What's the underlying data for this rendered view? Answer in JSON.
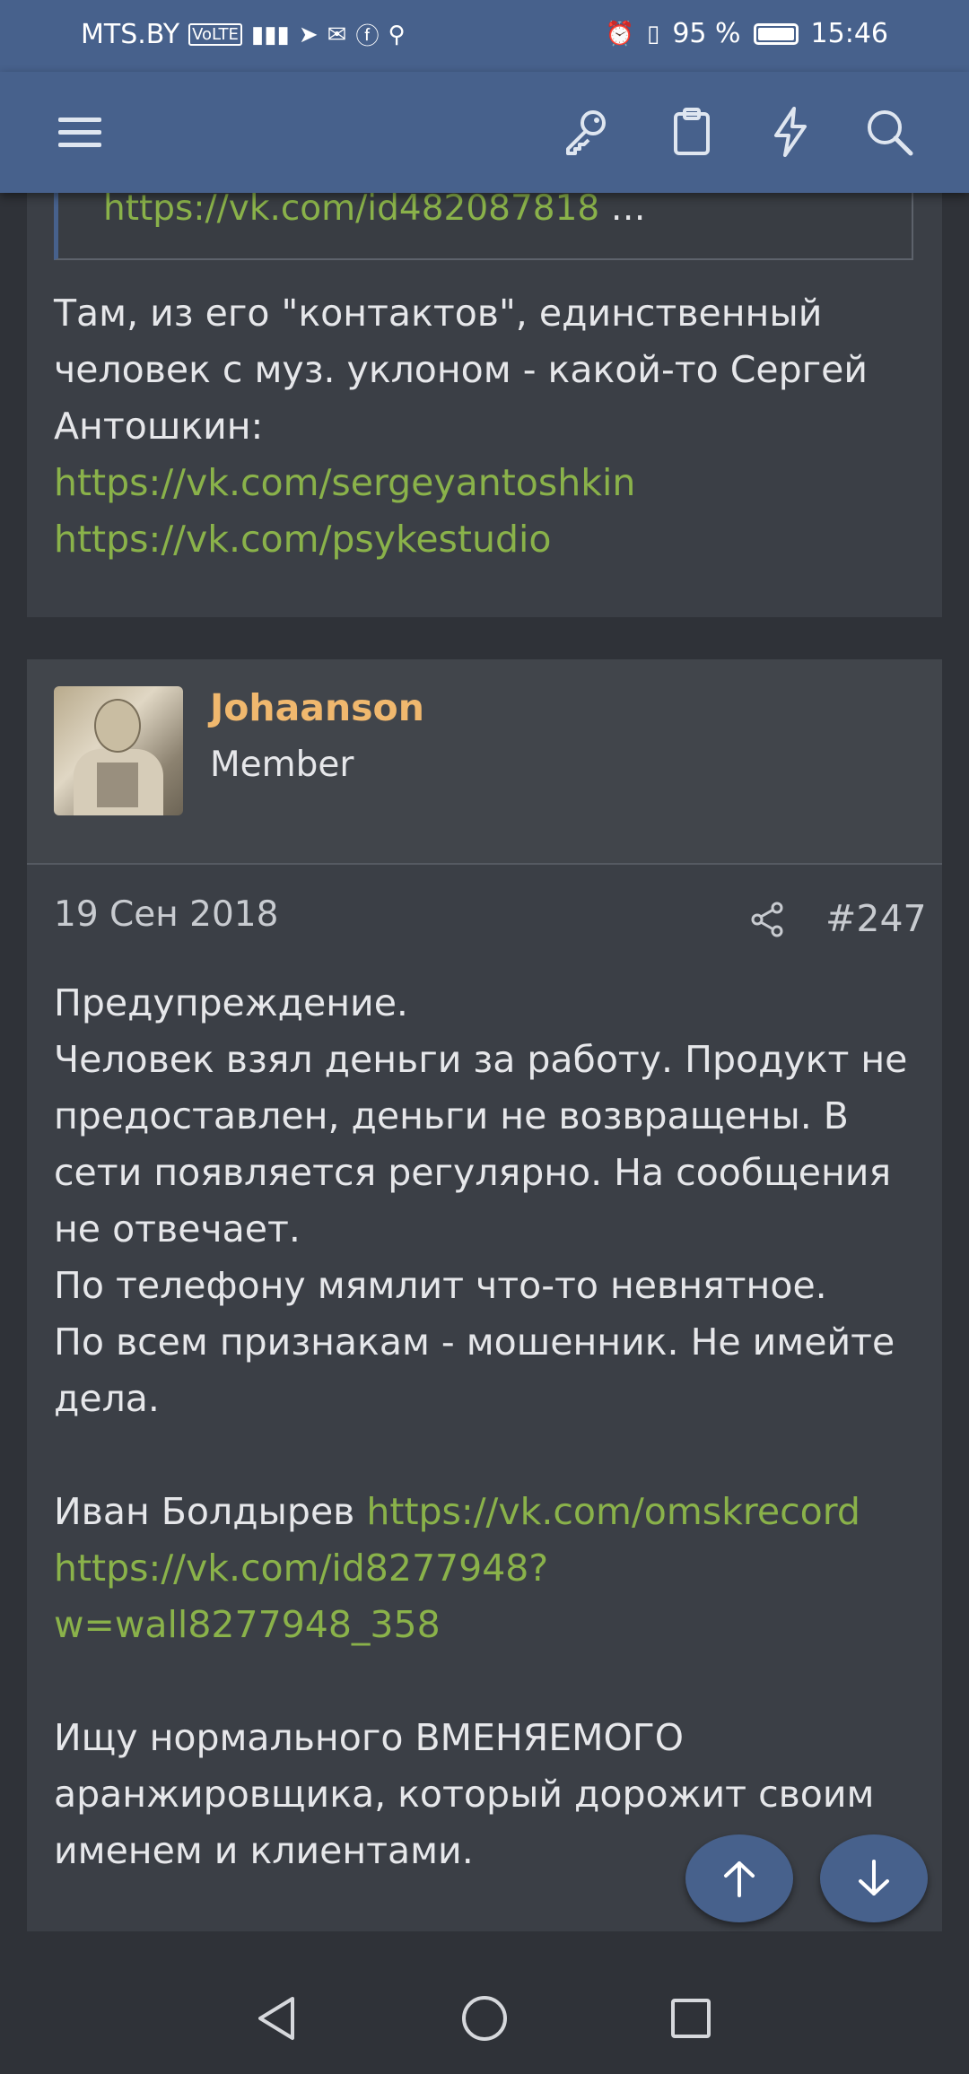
{
  "status_bar": {
    "carrier": "MTS.BY",
    "volte": "VoLTE",
    "battery": "95 %",
    "time": "15:46"
  },
  "toolbar": {
    "icons": [
      "menu-icon",
      "key-icon",
      "clipboard-icon",
      "bolt-icon",
      "search-icon"
    ]
  },
  "post_previous": {
    "quote_link": "https://vk.com/id482087818",
    "quote_ellipsis": " …",
    "text_line1": "Там, из его \"контактов\", единственный",
    "text_line2": "человек с муз. уклоном - какой-то Сергей",
    "text_line3": "Антошкин:",
    "link1": "https://vk.com/sergeyantoshkin",
    "link2": "https://vk.com/psykestudio"
  },
  "post": {
    "username": "Johaanson",
    "user_title": "Member",
    "date": "19 Сен 2018",
    "number": "#247",
    "line1": "Предупреждение.",
    "line2": "Человек взял деньги за работу. Продукт не",
    "line3": "предоставлен, деньги не возвращены. В",
    "line4": "сети появляется регулярно. На сообщения",
    "line5": "не отвечает.",
    "line6": "По телефону мямлит что-то невнятное.",
    "line7": "По всем признакам - мошенник. Не имейте",
    "line8": "дела.",
    "name_text": "Иван Болдырев ",
    "link_omsk": "https://vk.com/omskrecord",
    "link_wall_line1": "https://vk.com/id8277948?",
    "link_wall_line2": "w=wall8277948_358",
    "line9": "Ищу нормального ВМЕНЯЕМОГО",
    "line10": "аранжировщика, который дорожит своим",
    "line11": "именем и клиентами."
  }
}
